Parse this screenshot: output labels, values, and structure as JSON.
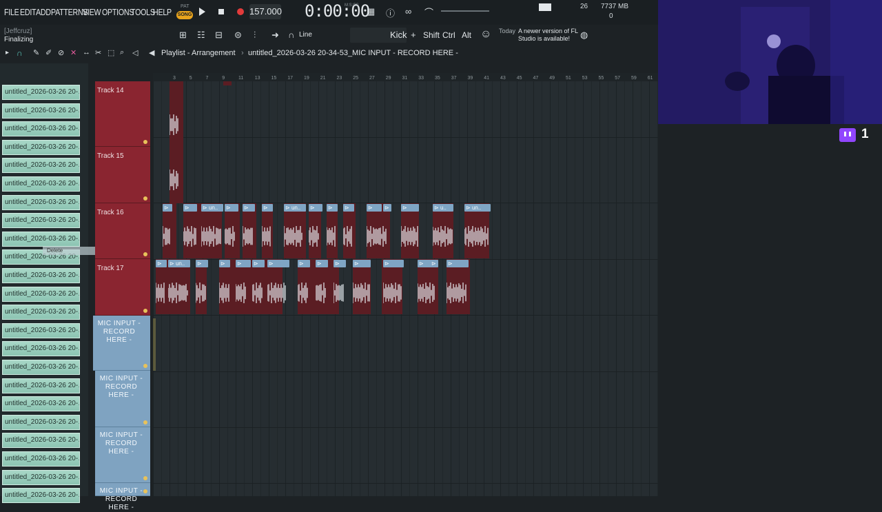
{
  "menu": [
    "FILE",
    "EDIT",
    "ADD",
    "PATTERNS",
    "VIEW",
    "OPTIONS",
    "TOOLS",
    "HELP"
  ],
  "transport": {
    "pat_label": "PAT",
    "song_label": "SONG",
    "tempo": "157.000",
    "time": "0:00:00",
    "time_unit": "M:S:CS"
  },
  "stats": {
    "cpu": "26",
    "memory": "7737 MB",
    "memory_sub": "0"
  },
  "hint": {
    "user": "[Jeffcruz]",
    "text": "Finalizing"
  },
  "toolbar": {
    "snap": "Line",
    "pattern": "Kick",
    "keys": [
      "Shift",
      "Ctrl",
      "Alt"
    ],
    "news_today": "Today",
    "news_text": "A newer version of FL Studio is available!"
  },
  "playlist": {
    "title": "Playlist - Arrangement",
    "separator": "›",
    "pattern": "untitled_2026-03-26 20-34-53_MIC INPUT - RECORD HERE -"
  },
  "patterns": [
    "untitled_2026-03-26 20-…",
    "untitled_2026-03-26 20-…",
    "untitled_2026-03-26 20-…",
    "untitled_2026-03-26 20-…",
    "untitled_2026-03-26 20-…",
    "untitled_2026-03-26 20-…",
    "untitled_2026-03-26 20-…",
    "untitled_2026-03-26 20-…",
    "untitled_2026-03-26 20-…",
    "untitled_2026-03-26 20-…",
    "untitled_2026-03-26 20-…",
    "untitled_2026-03-26 20-…",
    "untitled_2026-03-26 20-…",
    "untitled_2026-03-26 20-…",
    "untitled_2026-03-26 20-…",
    "untitled_2026-03-26 20-…",
    "untitled_2026-03-26 20-…",
    "untitled_2026-03-26 20-…",
    "untitled_2026-03-26 20-…",
    "untitled_2026-03-26 20-…",
    "untitled_2026-03-26 20-…",
    "untitled_2026-03-26 20-…",
    "untitled_2026-03-26 20-…"
  ],
  "tooltip": "Delete",
  "tracks": [
    "Track 14",
    "Track 15",
    "Track 16",
    "Track 17"
  ],
  "mic_tracks": [
    "MIC INPUT - RECORD HERE -",
    "MIC INPUT - RECORD HERE -",
    "MIC INPUT - RECORD HERE -",
    "MIC INPUT - RECORD HERE -"
  ],
  "ruler": [
    "3",
    "5",
    "7",
    "9",
    "11",
    "13",
    "15",
    "17",
    "19",
    "21",
    "23",
    "25",
    "27",
    "29",
    "31",
    "33",
    "35",
    "37",
    "39",
    "41",
    "43",
    "45",
    "47",
    "49",
    "51",
    "53",
    "55",
    "57",
    "59",
    "61"
  ],
  "clips_t16": [
    "",
    "",
    "un..",
    "",
    "",
    "",
    "un..",
    "",
    "",
    "",
    "",
    "",
    "",
    "u..",
    "un..",
    "unti.."
  ],
  "clips_t17": [
    "",
    "un..",
    "",
    "",
    "",
    "",
    "",
    "",
    "",
    "",
    "",
    "",
    "",
    "",
    "",
    "un.."
  ],
  "twitch_count": "1",
  "colors": {
    "track_red": "#8a2530",
    "mic_blue": "#7fa3c1",
    "pattern_green": "#a8d7c7",
    "accent": "#e9a41d"
  }
}
